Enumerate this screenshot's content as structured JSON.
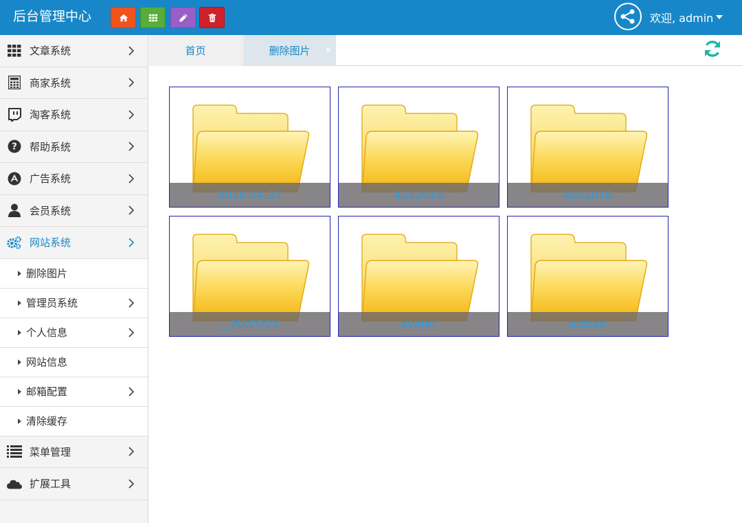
{
  "header": {
    "title": "后台管理中心",
    "quick_buttons": [
      {
        "name": "home",
        "icon": "home-icon",
        "color": "#f0531c"
      },
      {
        "name": "grid",
        "icon": "grid-icon",
        "color": "#56ad37"
      },
      {
        "name": "edit",
        "icon": "pencil-icon",
        "color": "#9a5ec7"
      },
      {
        "name": "delete",
        "icon": "trash-icon",
        "color": "#d0202a"
      }
    ],
    "welcome": "欢迎, admin"
  },
  "sidebar": {
    "items": [
      {
        "label": "文章系统",
        "icon": "grid-icon"
      },
      {
        "label": "商家系统",
        "icon": "calculator-icon"
      },
      {
        "label": "淘客系统",
        "icon": "twitch-icon"
      },
      {
        "label": "帮助系统",
        "icon": "question-icon"
      },
      {
        "label": "广告系统",
        "icon": "adn-icon"
      },
      {
        "label": "会员系统",
        "icon": "user-icon"
      },
      {
        "label": "网站系统",
        "icon": "gears-icon",
        "active": true
      }
    ],
    "subitems": [
      {
        "label": "删除图片",
        "has_chevron": false
      },
      {
        "label": "管理员系统",
        "has_chevron": true
      },
      {
        "label": "个人信息",
        "has_chevron": true
      },
      {
        "label": "网站信息",
        "has_chevron": false
      },
      {
        "label": "邮箱配置",
        "has_chevron": true
      },
      {
        "label": "清除缓存",
        "has_chevron": false
      }
    ],
    "bottom_items": [
      {
        "label": "菜单管理",
        "icon": "list-icon"
      },
      {
        "label": "扩展工具",
        "icon": "cloud-icon"
      }
    ]
  },
  "tabs": {
    "home": "首页",
    "current": "删除图片",
    "close": "×"
  },
  "folders": [
    {
      "name": "2016-04-27"
    },
    {
      "name": "4252016"
    },
    {
      "name": "4262016"
    },
    {
      "name": "__MACOSX"
    },
    {
      "name": "avatar"
    },
    {
      "name": "upload"
    }
  ],
  "colors": {
    "header": "#1787c9",
    "accent": "#1787c9",
    "refresh": "#1fb5a1",
    "folder_label": "#2a9ae0"
  }
}
